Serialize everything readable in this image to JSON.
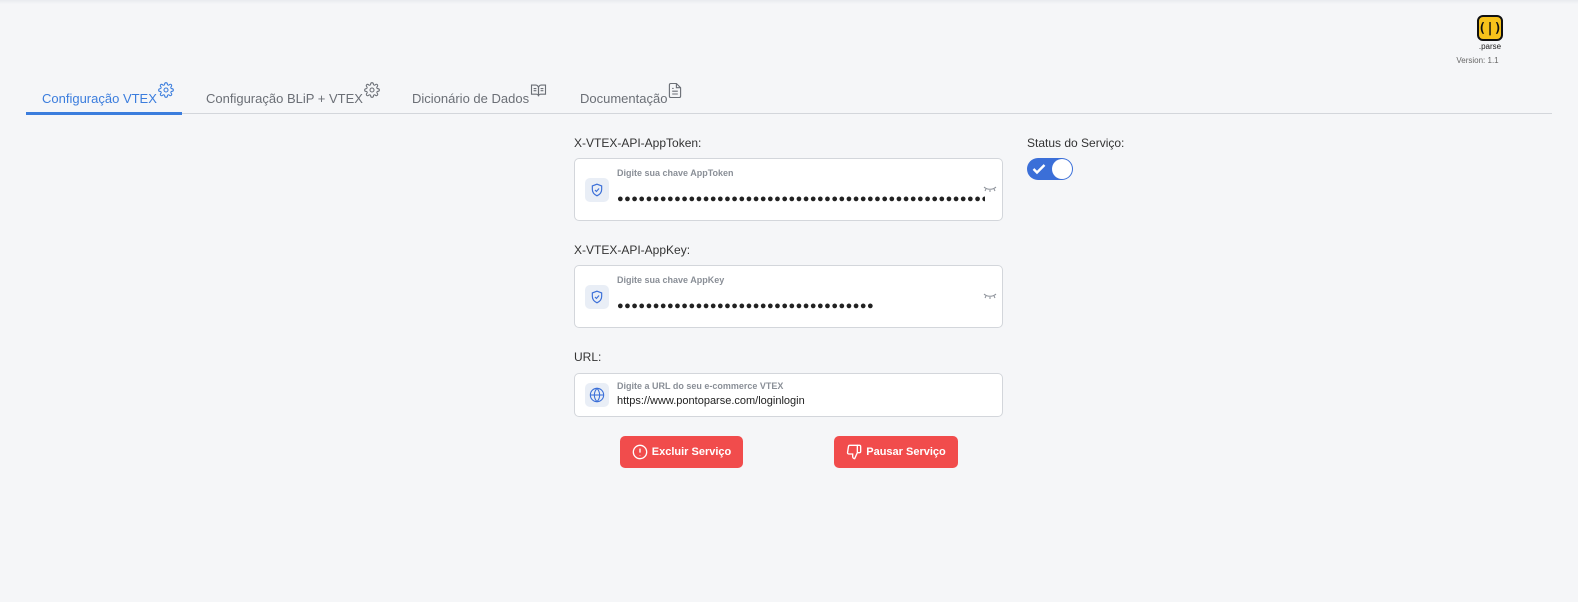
{
  "header": {
    "logo_text": ".parse",
    "version": "Version: 1.1"
  },
  "tabs": [
    {
      "label": "Configuração VTEX",
      "icon": "gear-icon",
      "active": true
    },
    {
      "label": "Configuração BLiP + VTEX",
      "icon": "gear-icon",
      "active": false
    },
    {
      "label": "Dicionário de Dados",
      "icon": "book-icon",
      "active": false
    },
    {
      "label": "Documentação",
      "icon": "document-icon",
      "active": false
    }
  ],
  "form": {
    "apptoken": {
      "label": "X-VTEX-API-AppToken:",
      "placeholder": "Digite sua chave AppToken",
      "value": "●●●●●●●●●●●●●●●●●●●●●●●●●●●●●●●●●●●●●●●●●●●●●●●●●●●●●●●●●●●●●●●●●●●●●●●●●●●",
      "icon": "shield-check-icon"
    },
    "appkey": {
      "label": "X-VTEX-API-AppKey:",
      "placeholder": "Digite sua chave AppKey",
      "value": "●●●●●●●●●●●●●●●●●●●●●●●●●●●●●●●●●●●●",
      "icon": "shield-check-icon"
    },
    "url": {
      "label": "URL:",
      "placeholder": "Digite a URL do seu e-commerce VTEX",
      "value": "https://www.pontoparse.com/loginlogin",
      "icon": "globe-icon"
    }
  },
  "status": {
    "label": "Status do Serviço:",
    "enabled": true
  },
  "buttons": {
    "delete_label": "Excluir Serviço",
    "pause_label": "Pausar Serviço"
  },
  "colors": {
    "accent": "#3b7ddd",
    "danger": "#f14c4c",
    "toggle": "#3b6fd8"
  }
}
